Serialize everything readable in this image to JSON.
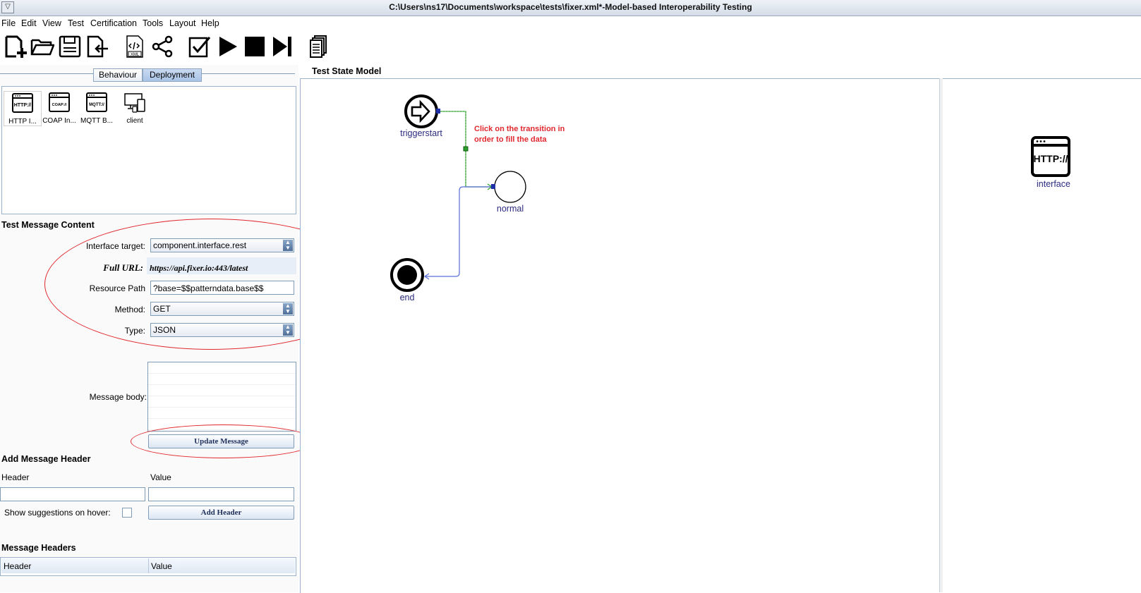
{
  "window": {
    "title": "C:\\Users\\ns17\\Documents\\workspace\\tests\\fixer.xml*-Model-based Interoperability Testing"
  },
  "menu": [
    "File",
    "Edit",
    "View",
    "Test",
    "Certification",
    "Tools",
    "Layout",
    "Help"
  ],
  "toolbar": {
    "buttons": [
      "new-icon",
      "open-folder-icon",
      "save-icon",
      "export-icon",
      "xml-icon",
      "share-icon",
      "check-icon",
      "play-icon",
      "stop-icon",
      "step-forward-icon",
      "copy-icon"
    ],
    "xml_label": "XML"
  },
  "left": {
    "tabs": {
      "behaviour": "Behaviour",
      "deployment": "Deployment"
    },
    "palette": [
      {
        "label": "HTTP I...",
        "icon": "http-interface-icon",
        "glyph": "HTTP://"
      },
      {
        "label": "COAP In...",
        "icon": "coap-interface-icon",
        "glyph": "COAP://"
      },
      {
        "label": "MQTT B...",
        "icon": "mqtt-broker-icon",
        "glyph": "MQTT://"
      },
      {
        "label": "client",
        "icon": "client-devices-icon",
        "glyph": ""
      }
    ],
    "test_message": {
      "title": "Test Message Content",
      "interface_label": "Interface target:",
      "interface_value": "component.interface.rest",
      "full_url_label": "Full URL:",
      "full_url_value": "https://api.fixer.io:443/latest",
      "resource_label": "Resource Path",
      "resource_value": "?base=$$patterndata.base$$",
      "method_label": "Method:",
      "method_value": "GET",
      "type_label": "Type:",
      "type_value": "JSON",
      "body_label": "Message body:",
      "update_button": "Update Message"
    },
    "header_section": {
      "title": "Add Message Header",
      "header_col": "Header",
      "value_col": "Value",
      "suggestions_label": "Show suggestions on hover:",
      "add_button": "Add Header"
    },
    "headers_table": {
      "title": "Message Headers",
      "columns": [
        "Header",
        "Value"
      ]
    }
  },
  "canvas": {
    "title": "Test State Model",
    "nodes": {
      "start": "triggerstart",
      "normal": "normal",
      "end": "end"
    },
    "annotation": [
      "Click on the transition in",
      "order to fill the data"
    ],
    "colors": {
      "annotation": "#e0282e",
      "node_label": "#2b2b80",
      "transition_green": "#2ca02c",
      "transition_blue": "#5a6fd6"
    }
  },
  "right": {
    "component_label": "interface",
    "component_glyph": "HTTP://"
  }
}
